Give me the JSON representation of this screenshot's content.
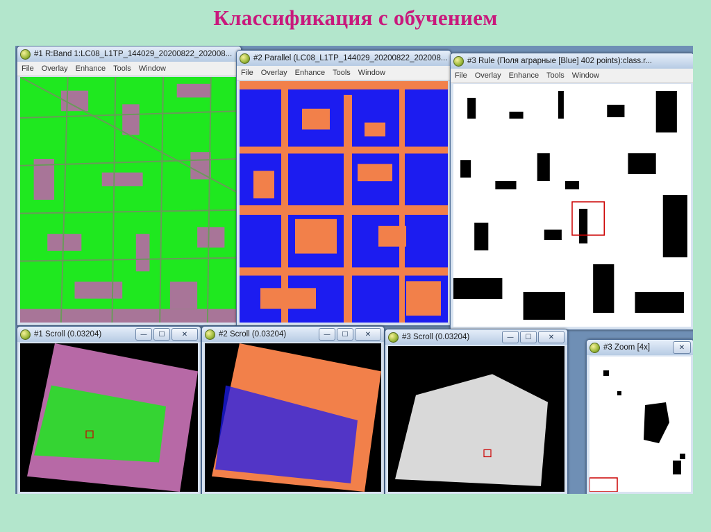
{
  "slide": {
    "title": "Классификация с обучением"
  },
  "menu_labels": [
    "File",
    "Overlay",
    "Enhance",
    "Tools",
    "Window"
  ],
  "windows": {
    "band": {
      "title": "#1 R:Band 1:LC08_L1TP_144029_20200822_202008..."
    },
    "parallel": {
      "title": "#2 Parallel (LC08_L1TP_144029_20200822_202008..."
    },
    "rule": {
      "title": "#3 Rule (Поля аграрные [Blue] 402 points):class.r..."
    },
    "scroll1": {
      "title": "#1 Scroll (0.03204)"
    },
    "scroll2": {
      "title": "#2 Scroll (0.03204)"
    },
    "scroll3": {
      "title": "#3 Scroll (0.03204)"
    },
    "zoom": {
      "title": "#3 Zoom [4x]"
    }
  },
  "controls": {
    "minimize": "—",
    "maximize": "☐",
    "close": "✕"
  },
  "colors": {
    "slide_background": "#b3e6cc",
    "title_color": "#c8197c",
    "vegetation_green": "#1fe81f",
    "non_field_magenta": "#b769a6",
    "class_blue": "#1c1cf0",
    "class_orange": "#f2804a",
    "mask_black": "#000000",
    "mask_white": "#ffffff",
    "zoom_box_red": "#cc0000"
  }
}
